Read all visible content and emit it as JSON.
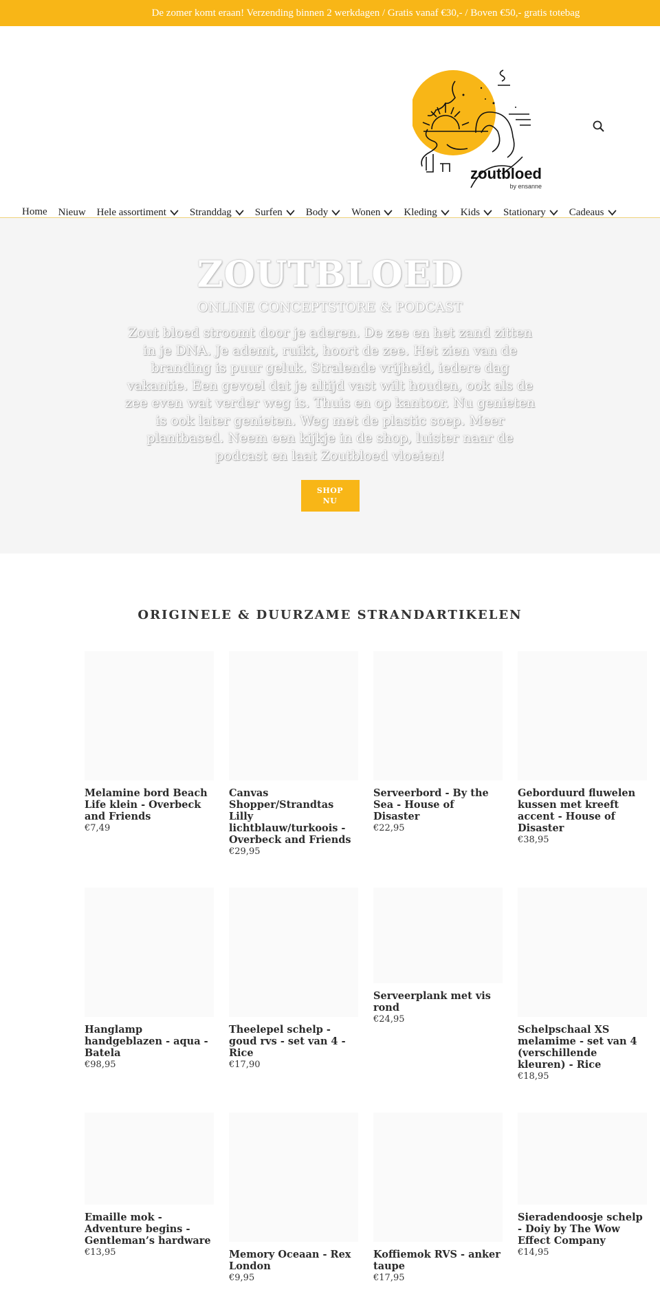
{
  "announcement": "De zomer komt eraan! Verzending binnen 2 werkdagen / Gratis vanaf €30,- / Boven €50,- gratis totebag",
  "logo": {
    "name": "zoutbloed",
    "tagline": "by ensanne",
    "color": "#f8b617"
  },
  "nav": [
    {
      "label": "Home",
      "active": true,
      "dropdown": false
    },
    {
      "label": "Nieuw",
      "dropdown": false
    },
    {
      "label": "Hele assortiment",
      "dropdown": true
    },
    {
      "label": "Stranddag",
      "dropdown": true
    },
    {
      "label": "Surfen",
      "dropdown": true
    },
    {
      "label": "Body",
      "dropdown": true
    },
    {
      "label": "Wonen",
      "dropdown": true
    },
    {
      "label": "Kleding",
      "dropdown": true
    },
    {
      "label": "Kids",
      "dropdown": true
    },
    {
      "label": "Stationary",
      "dropdown": true
    },
    {
      "label": "Cadeaus",
      "dropdown": true
    }
  ],
  "hero": {
    "title": "ZOUTBLOED",
    "subtitle": "ONLINE CONCEPTSTORE & PODCAST",
    "text": "Zout bloed stroomt door je aderen. De zee en het zand zitten in je DNA. Je ademt, ruikt, hoort de zee. Het zien van de branding is puur geluk. Stralende vrijheid, iedere dag vakantie. Een gevoel dat je altijd vast wilt houden, ook als de zee even wat verder weg is. Thuis en op kantoor. Nu genieten is ook later genieten. Weg met de plastic soep. Meer plantbased. Neem een kijkje in de shop, luister naar de podcast en laat Zoutbloed vloeien!",
    "button": "SHOP NU"
  },
  "section_title": "ORIGINELE & DUURZAME STRANDARTIKELEN",
  "products": [
    [
      {
        "title": "Melamine bord Beach Life klein - Overbeck and Friends",
        "price": "€7,49"
      },
      {
        "title": "Canvas Shopper/Strandtas Lilly lichtblauw/turkoois - Overbeck and Friends",
        "price": "€29,95"
      },
      {
        "title": "Serveerbord - By the Sea - House of Disaster",
        "price": "€22,95"
      },
      {
        "title": "Geborduurd fluwelen kussen met kreeft accent - House of Disaster",
        "price": "€38,95"
      }
    ],
    [
      {
        "title": "Hanglamp handgeblazen - aqua - Batela",
        "price": "€98,95"
      },
      {
        "title": "Theelepel schelp - goud rvs - set van 4 - Rice",
        "price": "€17,90"
      },
      {
        "title": "Serveerplank met vis rond",
        "price": "€24,95"
      },
      {
        "title": "Schelpschaal XS melamime - set van 4 (verschillende kleuren) - Rice",
        "price": "€18,95"
      }
    ],
    [
      {
        "title": "Emaille mok -Adventure begins - Gentleman’s hardware",
        "price": "€13,95"
      },
      {
        "title": "Memory Oceaan - Rex London",
        "price": "€9,95"
      },
      {
        "title": "Koffiemok RVS - anker taupe",
        "price": "€17,95"
      },
      {
        "title": "Sieradendoosje schelp - Doiy by The Wow Effect Company",
        "price": "€14,95"
      }
    ]
  ]
}
